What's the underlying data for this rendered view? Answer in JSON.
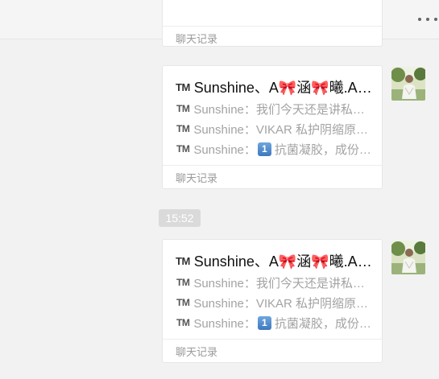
{
  "header": {
    "more_icon": "more-dots-icon"
  },
  "partial_card": {
    "footer_label": "聊天记录"
  },
  "time_separator": "15:52",
  "colors": {
    "background": "#f2f2f2",
    "card_bg": "#ffffff",
    "preview_text": "#a3a3a3",
    "time_badge": "#dadada"
  },
  "messages": [
    {
      "title": "Sunshine、A🎀涵🎀曦.Ann…",
      "lines": [
        {
          "text": "Sunshine：我们今天还是讲私护…"
        },
        {
          "text": "Sunshine：VIKAR 私护阴缩原…"
        },
        {
          "text": "Sunshine：",
          "badge": "1",
          "rest": "抗菌凝胶，成份…"
        }
      ],
      "footer_label": "聊天记录",
      "avatar_icon": "user-avatar-icon"
    },
    {
      "title": "Sunshine、A🎀涵🎀曦.Ann…",
      "lines": [
        {
          "text": "Sunshine：我们今天还是讲私护…"
        },
        {
          "text": "Sunshine：VIKAR 私护阴缩原…"
        },
        {
          "text": "Sunshine：",
          "badge": "1",
          "rest": "抗菌凝胶，成份…"
        }
      ],
      "footer_label": "聊天记录",
      "avatar_icon": "user-avatar-icon"
    }
  ]
}
